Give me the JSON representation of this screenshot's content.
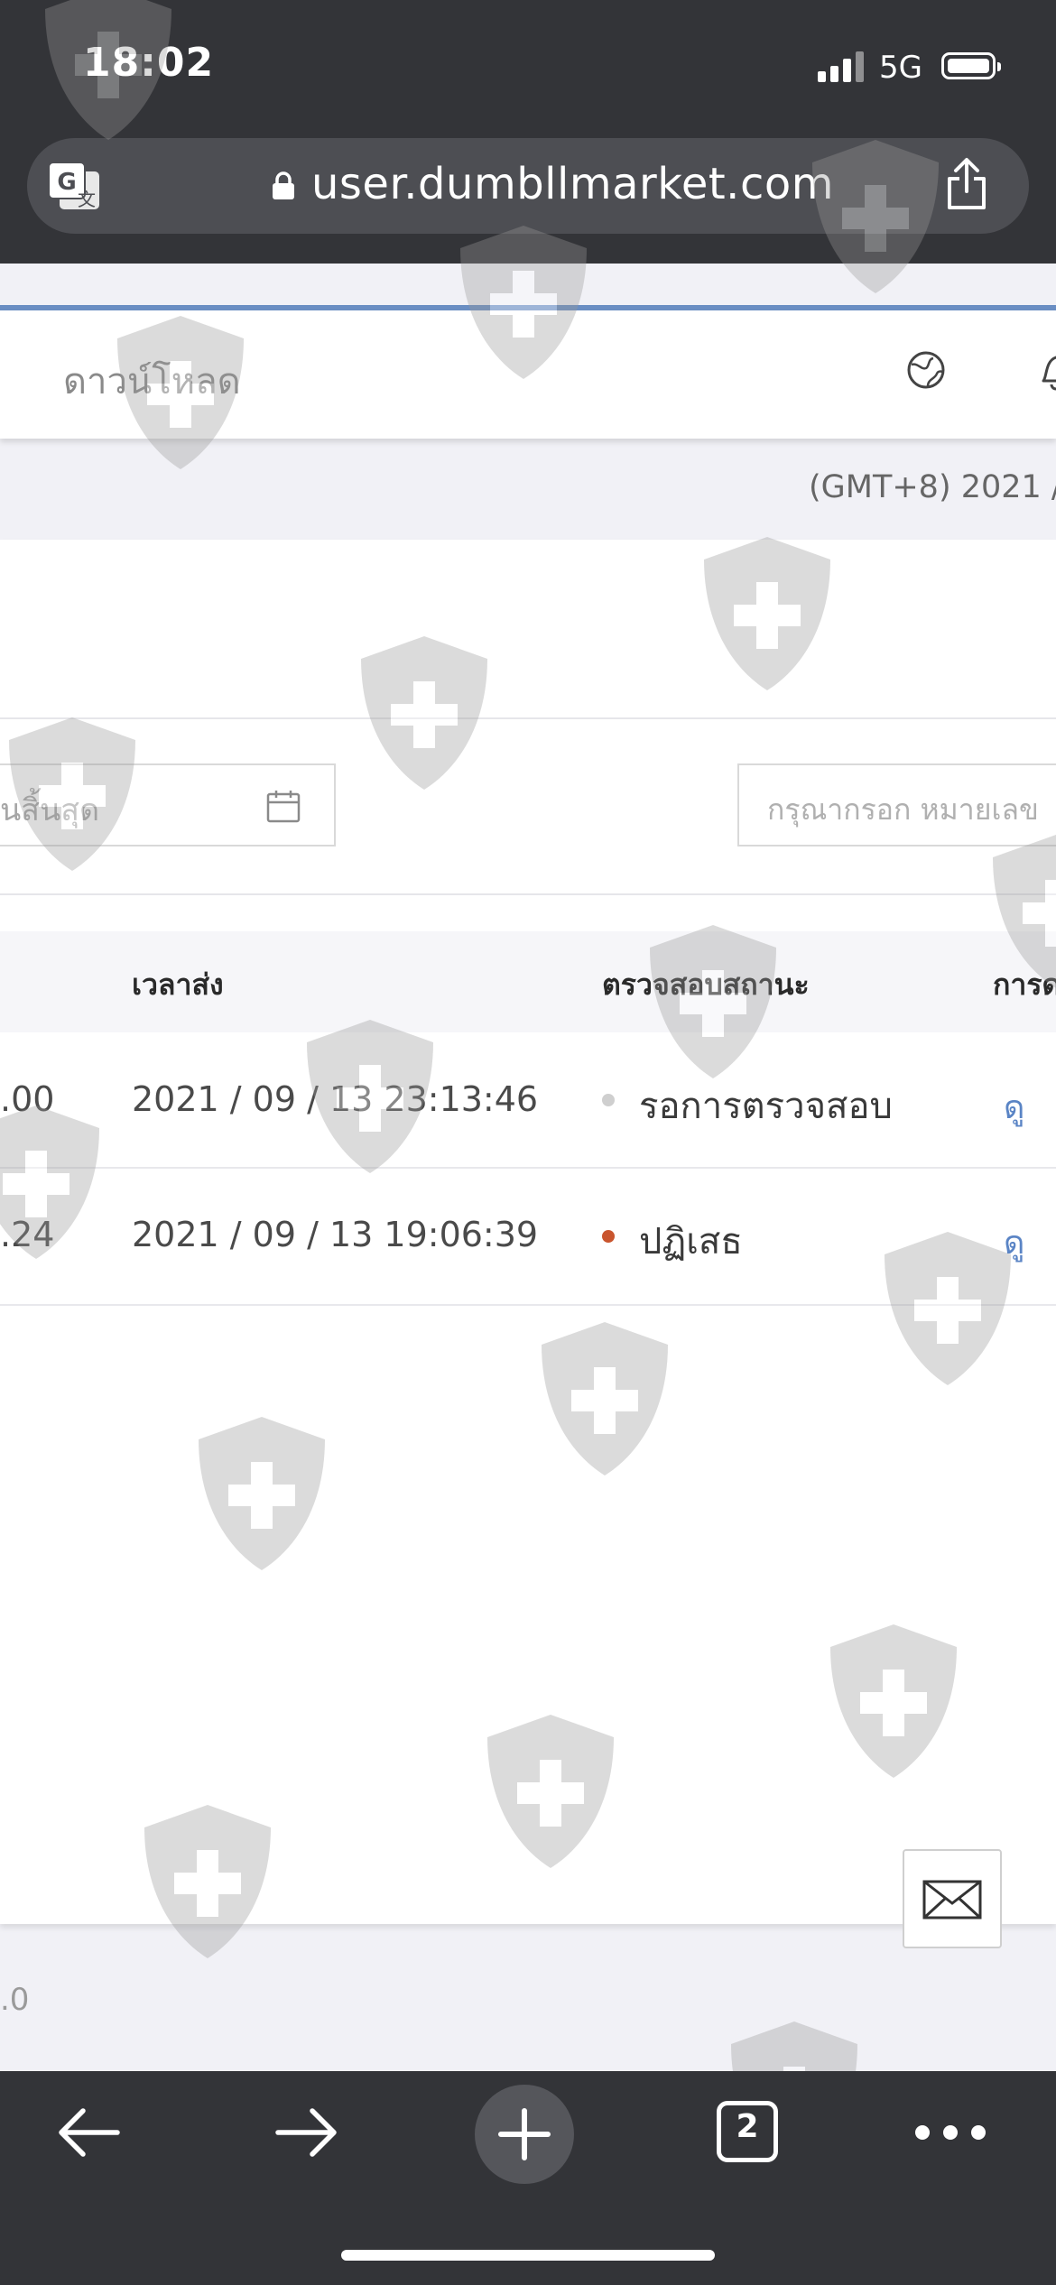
{
  "status_bar": {
    "time": "18:02",
    "network": "5G"
  },
  "browser": {
    "url": "user.dumbllmarket.com",
    "tab_count": "2"
  },
  "nav": {
    "download_label": "ดาวน์โหลด"
  },
  "timezone_text": "(GMT+8) 2021 /",
  "filters": {
    "end_date_placeholder": "นสิ้นสุด",
    "search_placeholder": "กรุณากรอก หมายเลข"
  },
  "table": {
    "headers": [
      "เวลาส่ง",
      "ตรวจสอบสถานะ",
      "การด"
    ],
    "rows": [
      {
        "amount": ".00",
        "time": "2021 / 09 / 13 23:13:46",
        "status": "รอการตรวจสอบ",
        "status_color": "#cfcfcf",
        "action": "ดู"
      },
      {
        "amount": ".24",
        "time": "2021 / 09 / 13 19:06:39",
        "status": "ปฏิเสธ",
        "status_color": "#c9552e",
        "action": "ดู"
      }
    ]
  },
  "footer": {
    "version_fragment": ".0"
  },
  "icons": {
    "translate": "translate-icon",
    "lock": "lock-icon",
    "share": "share-icon",
    "globe": "globe-icon",
    "bell": "bell-icon",
    "calendar": "calendar-icon",
    "mail": "mail-icon",
    "back": "back-icon",
    "forward": "forward-icon",
    "new_tab": "plus-icon",
    "more": "more-icon"
  },
  "colors": {
    "chrome_bg": "#333438",
    "accent": "#6a8ec3",
    "link": "#5a84c5",
    "rejected": "#c9552e"
  }
}
